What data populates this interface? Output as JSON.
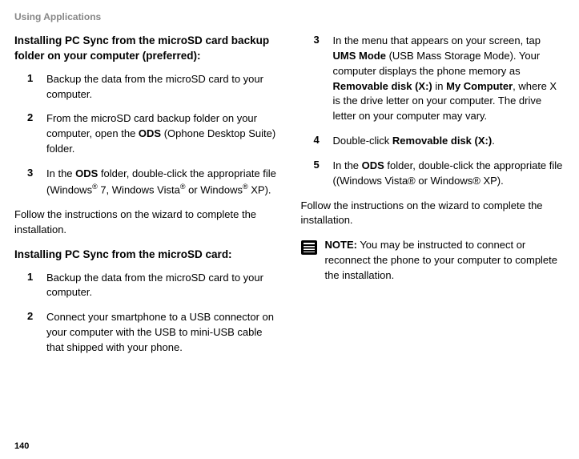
{
  "header": "Using Applications",
  "left": {
    "section1_title": "Installing PC Sync from the microSD card backup folder on your computer (preferred):",
    "items1": [
      {
        "n": "1",
        "text_before": "Backup the data from the microSD card to your computer."
      },
      {
        "n": "2",
        "text_before": "From the microSD card backup folder on your computer, open the ",
        "bold1": "ODS",
        "text_after": " (Ophone Desktop Suite) folder."
      },
      {
        "n": "3",
        "text_before": "In the ",
        "bold1": "ODS",
        "text_mid": " folder, double-click the appropriate file (Windows",
        "sup1": "®",
        "text_mid2": " 7, Windows Vista",
        "sup2": "®",
        "text_mid3": " or Windows",
        "sup3": "®",
        "text_after": " XP)."
      }
    ],
    "follow1": "Follow the instructions on the wizard to complete the installation.",
    "section2_title": "Installing PC Sync from the microSD card:",
    "items2": [
      {
        "n": "1",
        "text": "Backup the data from the microSD card to your computer."
      },
      {
        "n": "2",
        "text": "Connect your smartphone to a USB connector on your computer with the USB to mini-USB cable that shipped with your phone."
      }
    ]
  },
  "right": {
    "items": [
      {
        "n": "3",
        "t1": "In the menu that appears on your screen, tap ",
        "b1": "UMS Mode",
        "t2": " (USB Mass Storage Mode). Your computer displays the phone memory as ",
        "b2": "Removable disk (X:)",
        "t3": " in ",
        "b3": "My Computer",
        "t4": ", where X is the drive letter on your computer. The drive letter on your computer may vary."
      },
      {
        "n": "4",
        "t1": "Double-click ",
        "b1": "Removable disk (X:)",
        "t2": "."
      },
      {
        "n": "5",
        "t1": "In the ",
        "b1": "ODS",
        "t2": " folder, double-click the appropriate file ((Windows Vista® or Windows® XP)."
      }
    ],
    "follow": "Follow the instructions on the wizard to complete the installation.",
    "note_label": "NOTE:",
    "note_text": " You may be instructed to connect or reconnect the phone to your computer to complete the installation."
  },
  "page": "140"
}
